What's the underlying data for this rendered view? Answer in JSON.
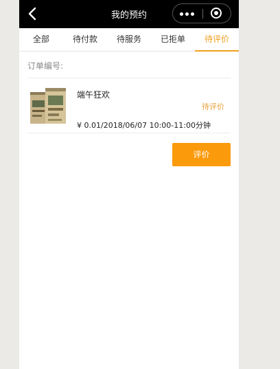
{
  "navbar": {
    "title": "我的预约",
    "back_icon": "chevron-left-icon",
    "more_icon": "more-dots-icon",
    "close_icon": "target-close-icon"
  },
  "tabs": [
    {
      "label": "全部"
    },
    {
      "label": "待付款"
    },
    {
      "label": "待服务"
    },
    {
      "label": "已拒单"
    },
    {
      "label": "待评价",
      "active": true
    }
  ],
  "order": {
    "order_no_label": "订单编号:",
    "product_name": "端午狂欢",
    "status": "待评价",
    "price_line": "¥ 0.01/2018/06/07 10:00-11:00分钟",
    "action_label": "评价"
  },
  "colors": {
    "accent": "#f0a020",
    "button": "#fb9a0a",
    "navbar": "#000000"
  }
}
